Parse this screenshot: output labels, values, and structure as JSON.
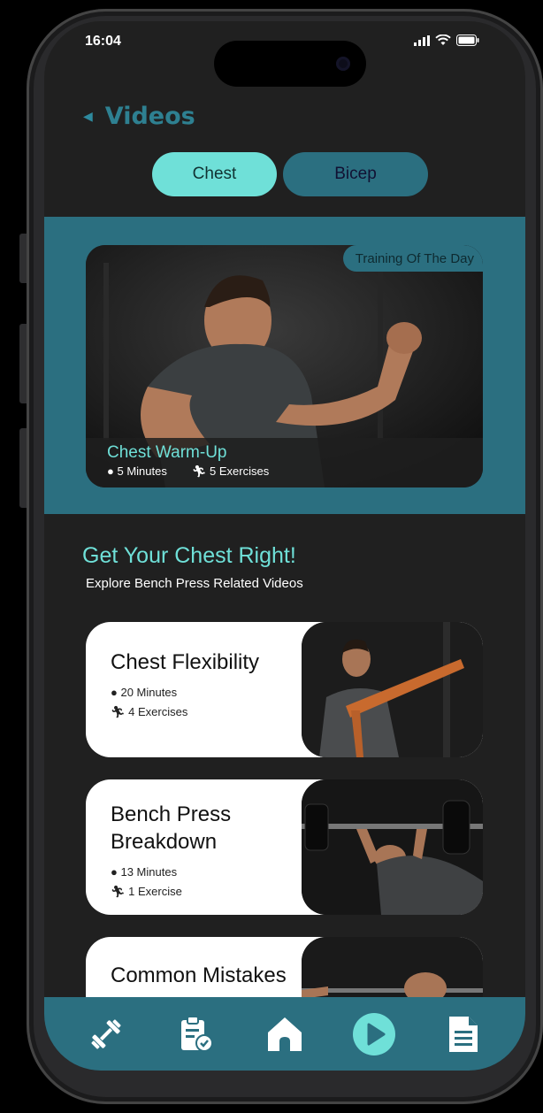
{
  "status": {
    "time": "16:04"
  },
  "header": {
    "back_icon": "chevron-left-icon",
    "title": "Videos"
  },
  "tabs": [
    {
      "label": "Chest",
      "active": true
    },
    {
      "label": "Bicep",
      "active": false
    }
  ],
  "featured": {
    "badge": "Training Of The Day",
    "title": "Chest Warm-Up",
    "duration": "5 Minutes",
    "exercises": "5 Exercises"
  },
  "section": {
    "title": "Get Your Chest Right!",
    "subtitle": "Explore Bench Press Related Videos"
  },
  "videos": [
    {
      "title": "Chest Flexibility",
      "duration": "20 Minutes",
      "exercises": "4 Exercises"
    },
    {
      "title": "Bench Press Breakdown",
      "duration": "13 Minutes",
      "exercises": "1 Exercise"
    },
    {
      "title": "Common Mistakes",
      "duration": "",
      "exercises": ""
    }
  ],
  "nav": [
    {
      "icon": "dumbbell-icon"
    },
    {
      "icon": "clipboard-check-icon"
    },
    {
      "icon": "home-icon"
    },
    {
      "icon": "play-circle-icon",
      "active": true
    },
    {
      "icon": "document-icon"
    }
  ],
  "colors": {
    "accent": "#6fe0d8",
    "band": "#2b6f80",
    "background": "#202020",
    "title": "#2e8091"
  }
}
